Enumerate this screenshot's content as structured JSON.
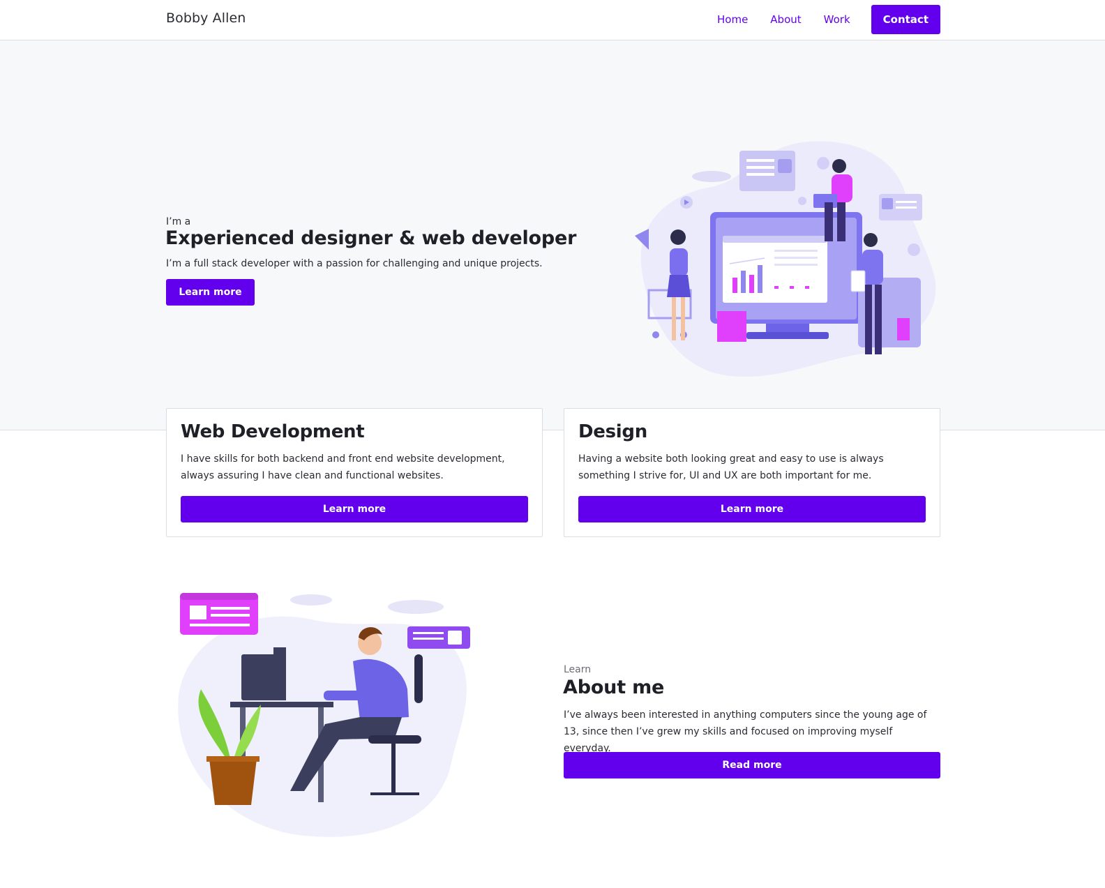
{
  "navbar": {
    "brand": "Bobby Allen",
    "links": [
      {
        "label": "Home"
      },
      {
        "label": "About"
      },
      {
        "label": "Work"
      }
    ],
    "cta_label": "Contact"
  },
  "hero": {
    "eyebrow": "I’m a",
    "title": "Experienced designer & web developer",
    "subtitle": "I’m a full stack developer with a passion for challenging and unique projects.",
    "button_label": "Learn more"
  },
  "cards": [
    {
      "title": "Web Development",
      "text": "I have skills for both backend and front end website development, always assuring I have clean and functional websites.",
      "button_label": "Learn more"
    },
    {
      "title": "Design",
      "text": "Having a website both looking great and easy to use is always something I strive for, UI and UX are both important for me.",
      "button_label": "Learn more"
    }
  ],
  "about": {
    "eyebrow": "Learn",
    "title": "About me",
    "text": "I’ve always been interested in anything computers since the young age of 13, since then I’ve grew my skills and focused on improving myself everyday.",
    "button_label": "Read more"
  },
  "colors": {
    "accent": "#6200ee",
    "hero_bg": "#f7f8fa",
    "border": "#dcdde3",
    "illustration_lavender": "#c9c6f5",
    "illustration_magenta": "#e040fb"
  }
}
